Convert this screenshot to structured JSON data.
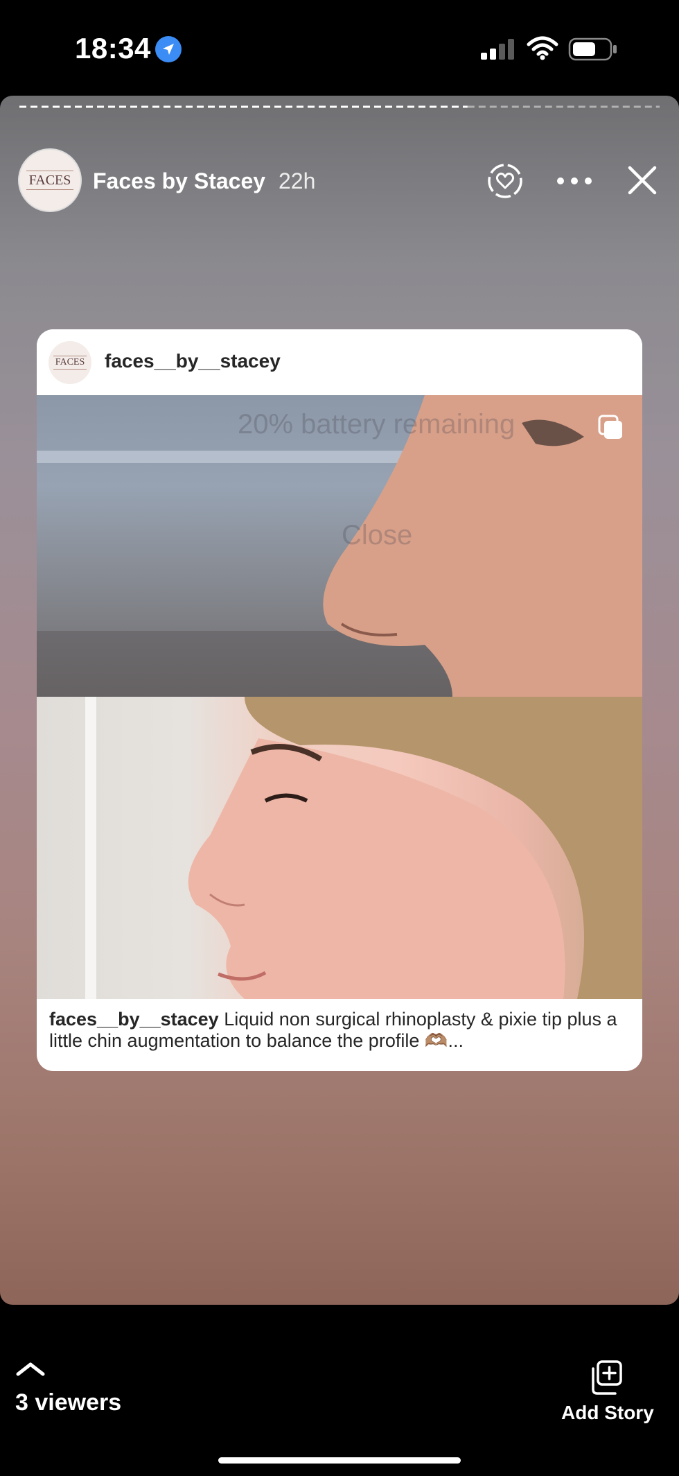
{
  "status_bar": {
    "time": "18:34",
    "icons": [
      "location-arrow-icon",
      "cellular-signal-icon",
      "wifi-icon",
      "battery-icon"
    ]
  },
  "story": {
    "progress_fraction": 0.7,
    "author": {
      "name": "Faces by Stacey",
      "age": "22h",
      "avatar_text": "FACES"
    },
    "header_icons": [
      "like-story-icon",
      "more-options-icon",
      "close-icon"
    ]
  },
  "post_card": {
    "username": "faces__by__stacey",
    "avatar_text": "FACES",
    "media_overlay_text": [
      "20% battery remaining",
      "Close"
    ],
    "caption_username": "faces__by__stacey",
    "caption_text": " Liquid non surgical rhinoplasty & pixie tip plus a little chin augmentation to balance the profile 🫶🏽..."
  },
  "bottom_bar": {
    "viewers_label": "3 viewers",
    "add_story_label": "Add Story"
  },
  "colors": {
    "accent_blue": "#3b8cf5",
    "background": "#000000",
    "card_bg": "#ffffff"
  }
}
